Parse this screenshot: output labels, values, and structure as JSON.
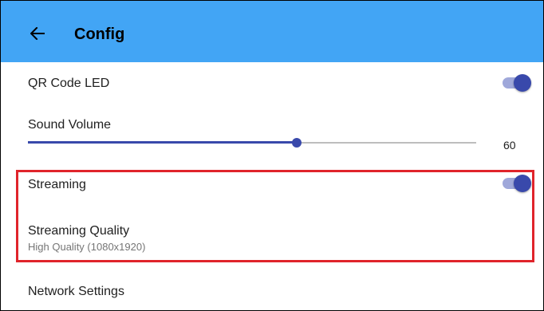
{
  "appbar": {
    "title": "Config",
    "back_icon": "arrow-left-icon",
    "color": "#42a5f5"
  },
  "settings": {
    "qr_led": {
      "title": "QR Code LED",
      "enabled": true
    },
    "sound_volume": {
      "title": "Sound Volume",
      "value": "60",
      "level": 60
    },
    "streaming": {
      "title": "Streaming",
      "enabled": true
    },
    "streaming_quality": {
      "title": "Streaming Quality",
      "summary": "High Quality (1080x1920)"
    },
    "network": {
      "title": "Network Settings"
    }
  },
  "colors": {
    "accent": "#3949ab",
    "accent_light": "#9fa8da",
    "highlight": "#e0242b"
  }
}
